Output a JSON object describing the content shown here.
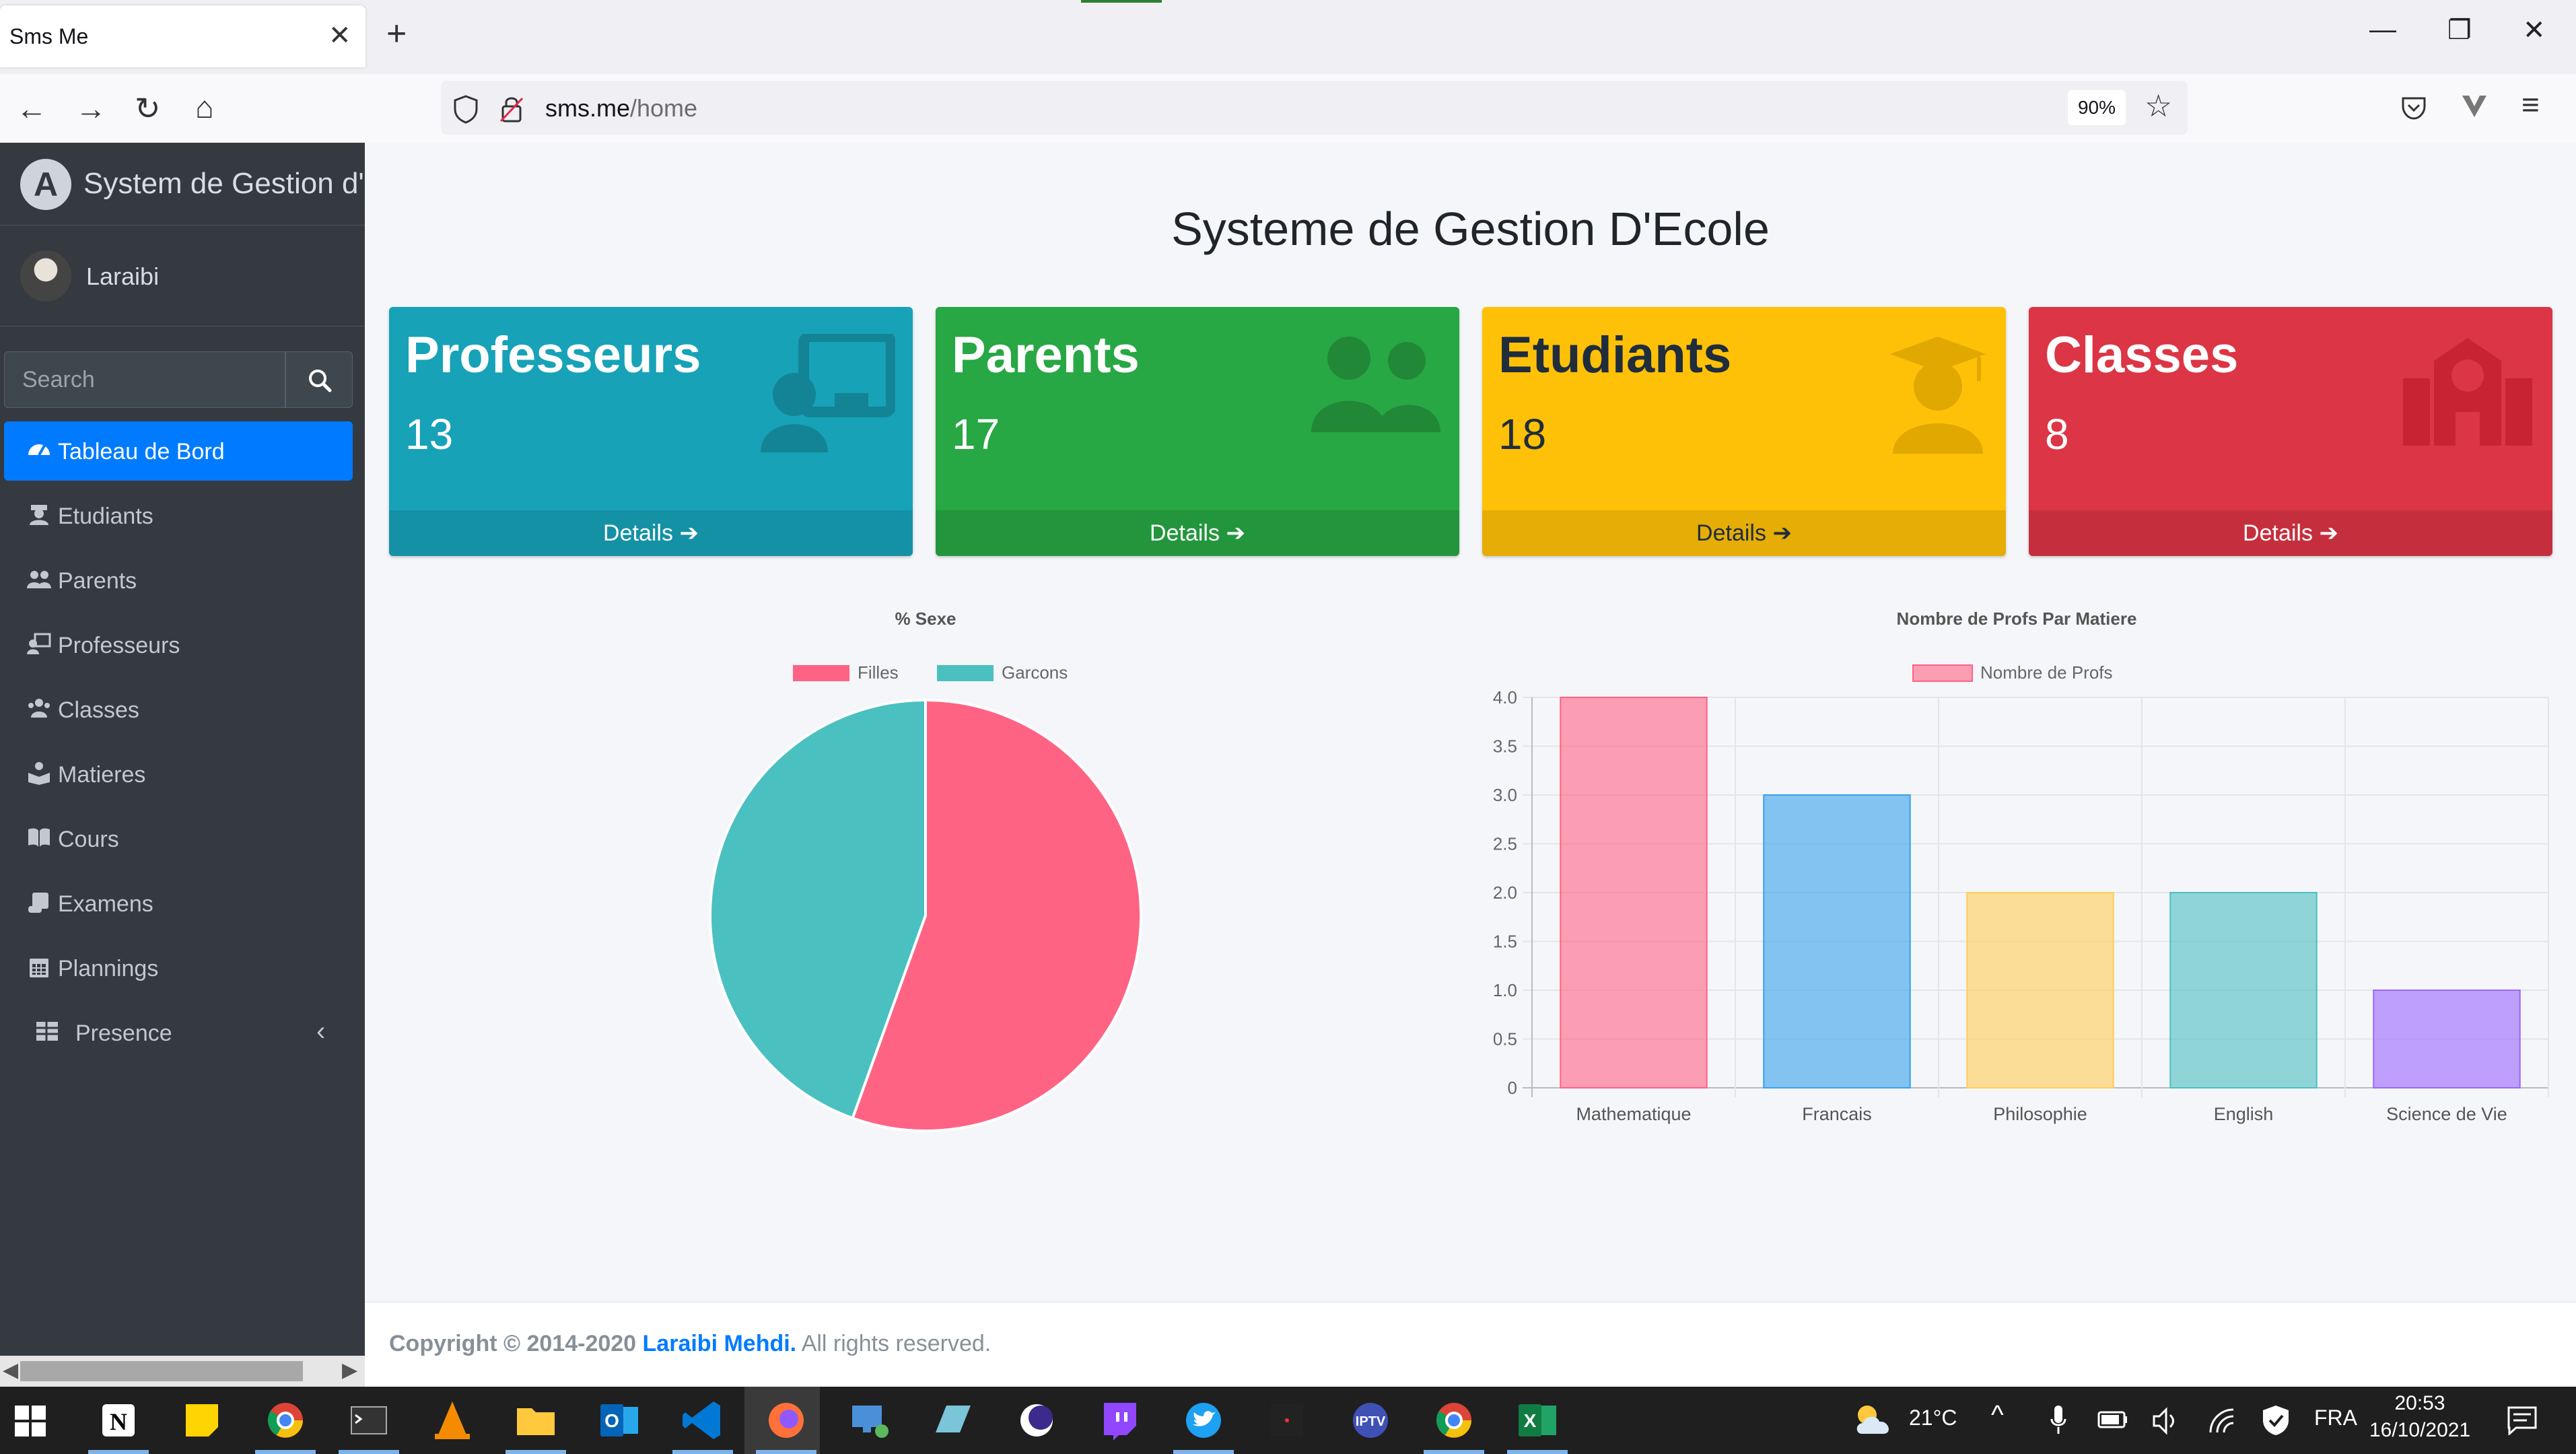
{
  "browser": {
    "tab_title": "Sms Me",
    "url_host": "sms.me",
    "url_path": "/home",
    "zoom": "90%"
  },
  "sidebar": {
    "brand": "System de Gestion d'école",
    "user": "Laraibi",
    "search_placeholder": "Search",
    "items": [
      {
        "label": "Tableau de Bord",
        "icon": "tachometer-icon",
        "active": true
      },
      {
        "label": "Etudiants",
        "icon": "student-icon"
      },
      {
        "label": "Parents",
        "icon": "users-icon"
      },
      {
        "label": "Professeurs",
        "icon": "teacher-icon"
      },
      {
        "label": "Classes",
        "icon": "group-icon"
      },
      {
        "label": "Matieres",
        "icon": "book-reader-icon"
      },
      {
        "label": "Cours",
        "icon": "book-open-icon"
      },
      {
        "label": "Examens",
        "icon": "scroll-icon"
      },
      {
        "label": "Plannings",
        "icon": "calendar-icon"
      },
      {
        "label": "Presence",
        "icon": "table-icon"
      }
    ]
  },
  "page": {
    "title": "Systeme de Gestion D'Ecole"
  },
  "cards": [
    {
      "title": "Professeurs",
      "count": "13",
      "link": "Details",
      "color": "#17a2b8"
    },
    {
      "title": "Parents",
      "count": "17",
      "link": "Details",
      "color": "#28a745"
    },
    {
      "title": "Etudiants",
      "count": "18",
      "link": "Details",
      "color": "#ffc107"
    },
    {
      "title": "Classes",
      "count": "8",
      "link": "Details",
      "color": "#dc3545"
    }
  ],
  "chart_data": [
    {
      "type": "pie",
      "title": "% Sexe",
      "legend": "top",
      "categories": [
        "Filles",
        "Garcons"
      ],
      "values": [
        55.5,
        44.5
      ],
      "colors": [
        "#ff6384",
        "#4bc0c0"
      ]
    },
    {
      "type": "bar",
      "title": "Nombre de Profs Par Matiere",
      "legend": "top",
      "series": [
        {
          "name": "Nombre de Profs",
          "values": [
            4,
            3,
            2,
            2,
            1
          ]
        }
      ],
      "categories": [
        "Mathematique",
        "Francais",
        "Philosophie",
        "English",
        "Science de Vie"
      ],
      "ylim": [
        0,
        4
      ],
      "yticks": [
        "0",
        "0.5",
        "1.0",
        "1.5",
        "2.0",
        "2.5",
        "3.0",
        "3.5",
        "4.0"
      ],
      "grid": true,
      "colors": [
        "#ff6384",
        "#36a2eb",
        "#ffcd56",
        "#4bc0c0",
        "#9966ff"
      ]
    }
  ],
  "footer": {
    "copy_prefix": "Copyright © 2014-2020 ",
    "author": "Laraibi Mehdi.",
    "suffix": " All rights reserved."
  },
  "taskbar": {
    "temperature": "21°C",
    "lang": "FRA",
    "time": "20:53",
    "date": "16/10/2021"
  }
}
